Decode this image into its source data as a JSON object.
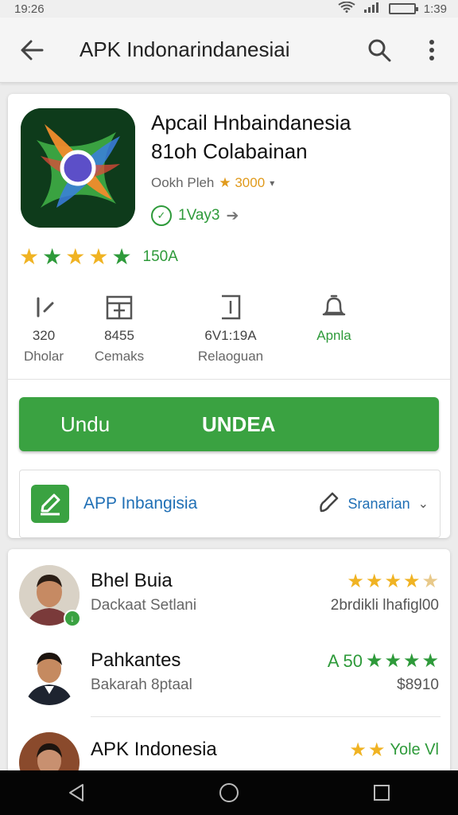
{
  "status_bar": {
    "time": "19:26",
    "clock_right": "1:39"
  },
  "app_bar": {
    "title": "APK Indonarindanesiai"
  },
  "app": {
    "name_line1": "Apcail Hnbaindanesia",
    "name_line2": "81oh Colabainan",
    "developer": "Ookh Pleh",
    "dev_rating": "★ 3000",
    "tag": "1Vay3",
    "rating_count": "150A"
  },
  "stats": [
    {
      "value": "320",
      "label": "Dholar",
      "icon": "edit-icon"
    },
    {
      "value": "8455",
      "label": "Cemaks",
      "icon": "calendar-icon"
    },
    {
      "value": "6V1:19A",
      "label": "Relaoguan",
      "icon": "file-icon"
    },
    {
      "value": "",
      "label": "Apnla",
      "icon": "bell-icon"
    }
  ],
  "install": {
    "left_label": "Undu",
    "right_label": "UNDEA"
  },
  "feature": {
    "label": "APP Inbangisia",
    "action": "Sranarian"
  },
  "reviews": [
    {
      "name": "Bhel Buia",
      "subtitle": "Dackaat Setlani",
      "meta": "2brdikli lhafigl00",
      "stars_label": ""
    },
    {
      "name": "Pahkantes",
      "subtitle": "Bakarah 8ptaal",
      "meta": "$8910",
      "stars_label": "A 50"
    },
    {
      "name": "APK Indonesia",
      "subtitle": "",
      "meta": "",
      "stars_label": "Yole Vl"
    }
  ],
  "colors": {
    "accent_green": "#3aa241",
    "star_yellow": "#f0b323",
    "link_blue": "#1f6fb5"
  }
}
